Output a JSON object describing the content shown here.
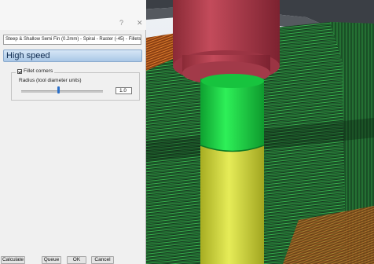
{
  "dialog": {
    "help_glyph": "?",
    "close_glyph": "✕",
    "strategy_name": "Steep & Shallow Semi Fin (0.2mm) - Spiral - Raster (-45) - Fillets",
    "section_title": "High speed",
    "fillet_corners_label": "Fillet corners",
    "fillet_corners_checked": true,
    "radius_label": "Radius (tool diameter units)",
    "radius_value": "1.0",
    "slider_position": 0.45
  },
  "buttons": {
    "calculate": "Calculate",
    "queue": "Queue",
    "ok": "OK",
    "cancel": "Cancel"
  },
  "colors": {
    "header_blue": "#a9c7e6",
    "slider_thumb": "#2a6fc9",
    "toolholder_red": "#b3394b",
    "tool_green": "#1ed846",
    "tool_yellow": "#d9df3f",
    "toolpath_green": "#1faa3a",
    "orange_region": "#e0782a"
  }
}
